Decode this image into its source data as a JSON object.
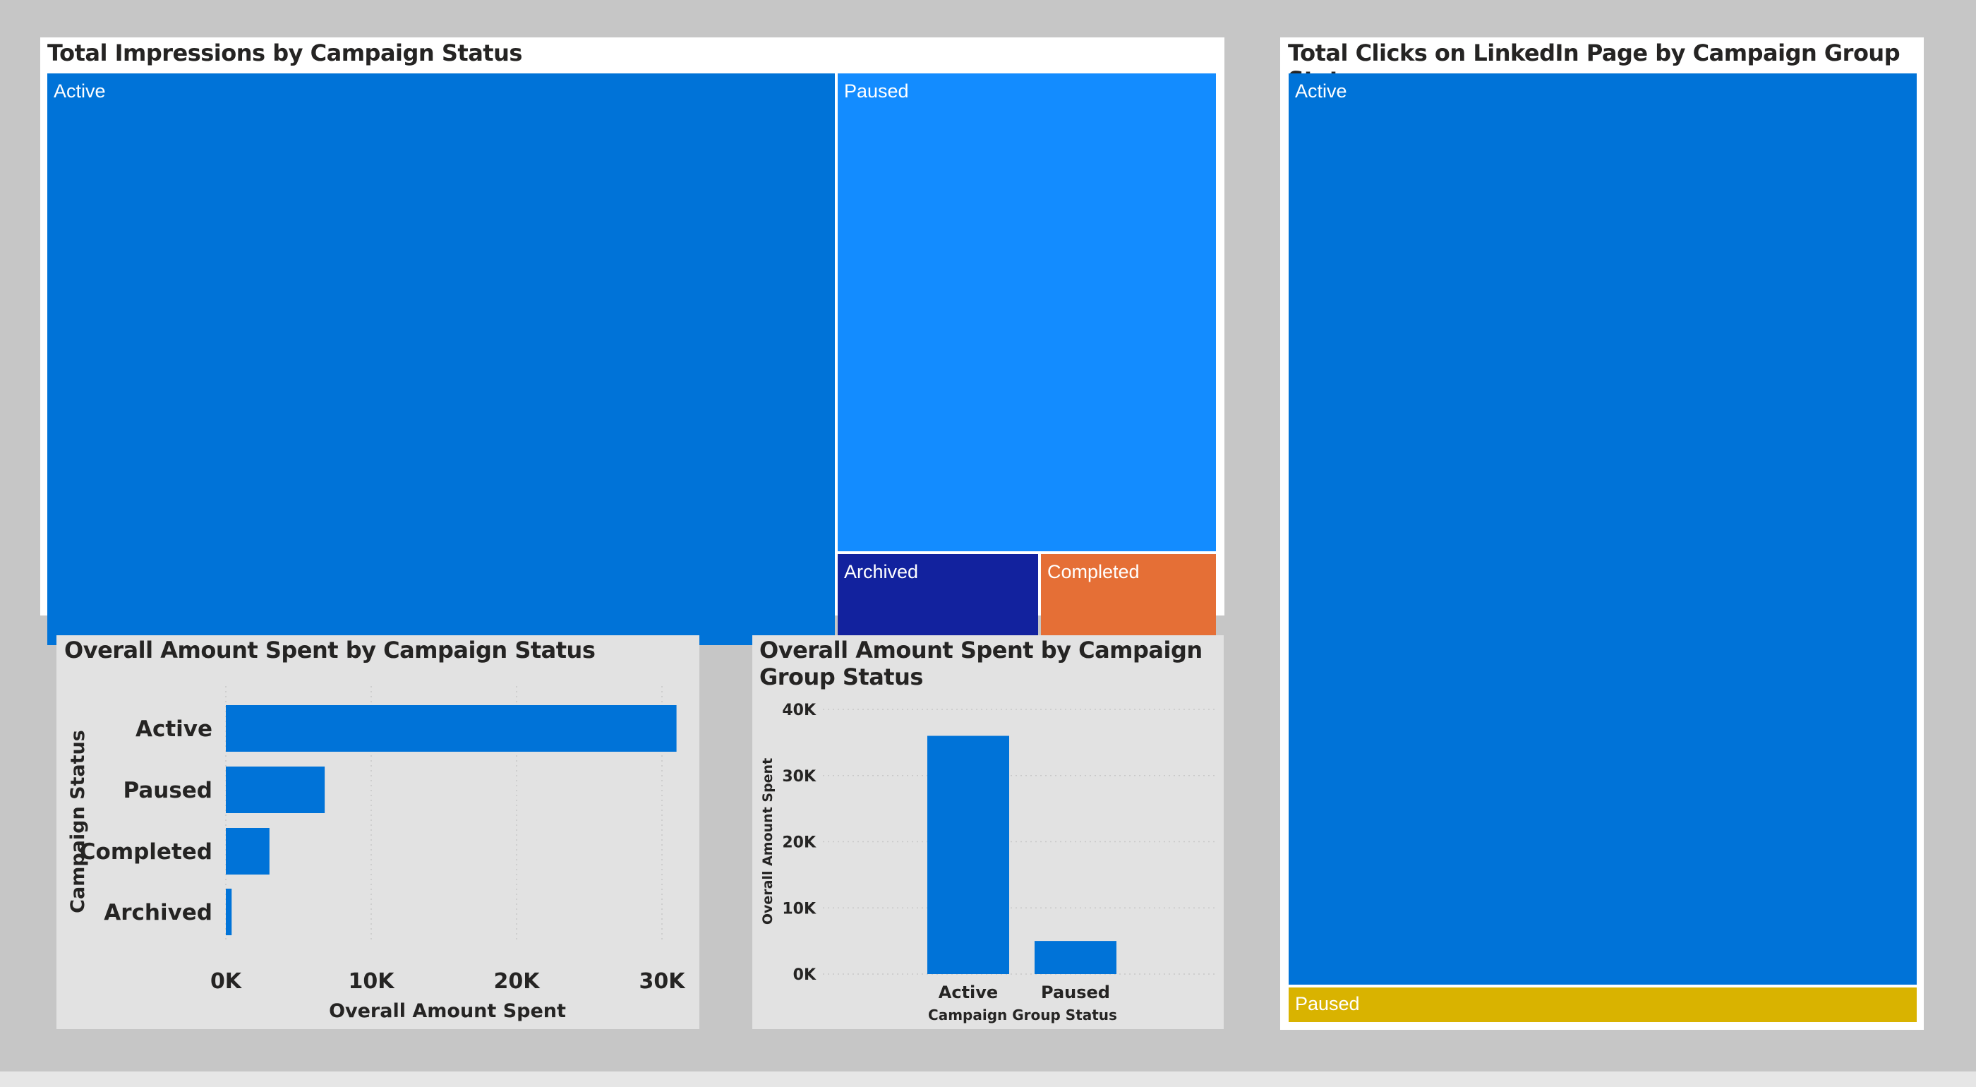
{
  "colors": {
    "page_bg": "#c6c6c6",
    "active": "#0073d8",
    "paused_light": "#138cff",
    "archived": "#12229e",
    "completed": "#e56f36",
    "paused_gold": "#d9b300",
    "bar": "#0073d8",
    "grid": "#c8c8c8"
  },
  "chart_data": [
    {
      "type": "treemap",
      "title": "Total Impressions by Campaign Status",
      "categories": [
        "Active",
        "Paused",
        "Archived",
        "Completed"
      ]
    },
    {
      "type": "treemap",
      "title": "Total Clicks on LinkedIn Page by Campaign Group Status",
      "categories": [
        "Active",
        "Paused"
      ]
    },
    {
      "type": "bar",
      "orientation": "horizontal",
      "title": "Overall Amount Spent by Campaign Status",
      "categories": [
        "Active",
        "Paused",
        "Completed",
        "Archived"
      ],
      "values": [
        31000,
        6800,
        3000,
        400
      ],
      "xlabel": "Overall Amount Spent",
      "ylabel": "Campaign Status",
      "xlim": [
        0,
        35000
      ],
      "xticks": [
        "0K",
        "10K",
        "20K",
        "30K"
      ],
      "grid": true
    },
    {
      "type": "bar",
      "orientation": "vertical",
      "title": "Overall Amount Spent by Campaign Group Status",
      "categories": [
        "Active",
        "Paused"
      ],
      "values": [
        36000,
        5000
      ],
      "xlabel": "Campaign Group Status",
      "ylabel": "Overall Amount Spent",
      "ylim": [
        0,
        40000
      ],
      "yticks": [
        "0K",
        "10K",
        "20K",
        "30K",
        "40K"
      ],
      "grid": true
    }
  ]
}
